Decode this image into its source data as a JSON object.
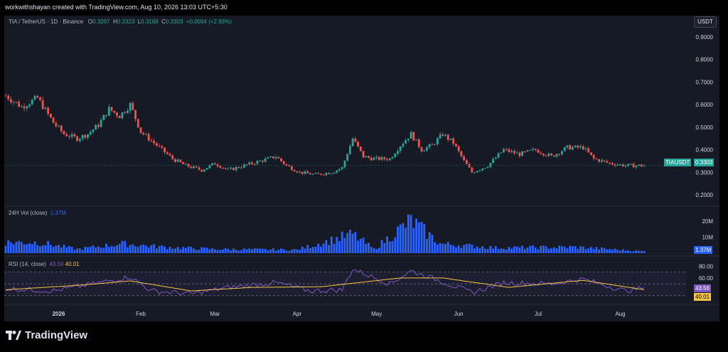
{
  "header": {
    "credit": "workwithshayan created with TradingView.com, Aug 10, 2026 13:03 UTC+5:30"
  },
  "legend": {
    "symbol": "TIA / TetherUS · 1D · Binance",
    "o_label": "O",
    "o": "0.3207",
    "h_label": "H",
    "h": "0.3323",
    "l_label": "L",
    "l": "0.3188",
    "c_label": "C",
    "c": "0.3303",
    "change": "+0.0094 (+2.93%)"
  },
  "currency": "USDT",
  "price_tag": {
    "symbol": "TIAUSDT",
    "value": "0.3303"
  },
  "volume": {
    "label": "24H Vol (close)",
    "value": "1.37M",
    "tag": "1.37M",
    "axis": [
      "20M",
      "10M"
    ]
  },
  "rsi": {
    "label": "RSI (14, close)",
    "value1": "43.56",
    "value2": "40.01",
    "axis": [
      "80.00",
      "60.00"
    ],
    "tag1": "43.56",
    "tag2": "40.01"
  },
  "footer": {
    "brand": "TradingView"
  },
  "colors": {
    "up": "#26a69a",
    "down": "#ef5350",
    "volume": "#2962ff",
    "rsi": "#7e57c2",
    "rsi_ma": "#f7c548",
    "tag_green": "#26a69a"
  },
  "chart_data": [
    {
      "type": "candlestick",
      "title": "TIA / TetherUS · 1D · Binance",
      "ylim": [
        0.15,
        0.95
      ],
      "y_ticks": [
        "0.9000",
        "0.8000",
        "0.7000",
        "0.6000",
        "0.5000",
        "0.4000",
        "0.3000",
        "0.2000"
      ],
      "x_ticks": [
        "2026",
        "Feb",
        "Mar",
        "Apr",
        "May",
        "Jun",
        "Jul",
        "Aug"
      ],
      "last_close": 0.3303,
      "close_path": [
        [
          "2025-12-12",
          0.64
        ],
        [
          "2025-12-18",
          0.59
        ],
        [
          "2025-12-24",
          0.63
        ],
        [
          "2025-12-30",
          0.52
        ],
        [
          "2026-01-03",
          0.47
        ],
        [
          "2026-01-08",
          0.45
        ],
        [
          "2026-01-12",
          0.47
        ],
        [
          "2026-01-16",
          0.51
        ],
        [
          "2026-01-20",
          0.58
        ],
        [
          "2026-01-24",
          0.55
        ],
        [
          "2026-01-28",
          0.6
        ],
        [
          "2026-02-01",
          0.48
        ],
        [
          "2026-02-05",
          0.44
        ],
        [
          "2026-02-09",
          0.4
        ],
        [
          "2026-02-13",
          0.36
        ],
        [
          "2026-02-18",
          0.33
        ],
        [
          "2026-02-24",
          0.31
        ],
        [
          "2026-03-01",
          0.34
        ],
        [
          "2026-03-06",
          0.31
        ],
        [
          "2026-03-12",
          0.33
        ],
        [
          "2026-03-18",
          0.35
        ],
        [
          "2026-03-24",
          0.37
        ],
        [
          "2026-03-28",
          0.33
        ],
        [
          "2026-04-02",
          0.3
        ],
        [
          "2026-04-08",
          0.29
        ],
        [
          "2026-04-14",
          0.3
        ],
        [
          "2026-04-18",
          0.32
        ],
        [
          "2026-04-22",
          0.45
        ],
        [
          "2026-04-26",
          0.37
        ],
        [
          "2026-04-30",
          0.36
        ],
        [
          "2026-05-06",
          0.36
        ],
        [
          "2026-05-10",
          0.42
        ],
        [
          "2026-05-14",
          0.47
        ],
        [
          "2026-05-18",
          0.4
        ],
        [
          "2026-05-22",
          0.42
        ],
        [
          "2026-05-26",
          0.47
        ],
        [
          "2026-05-30",
          0.43
        ],
        [
          "2026-06-03",
          0.35
        ],
        [
          "2026-06-06",
          0.3
        ],
        [
          "2026-06-12",
          0.33
        ],
        [
          "2026-06-18",
          0.4
        ],
        [
          "2026-06-24",
          0.38
        ],
        [
          "2026-06-30",
          0.4
        ],
        [
          "2026-07-06",
          0.37
        ],
        [
          "2026-07-12",
          0.41
        ],
        [
          "2026-07-18",
          0.41
        ],
        [
          "2026-07-22",
          0.36
        ],
        [
          "2026-07-28",
          0.34
        ],
        [
          "2026-08-03",
          0.33
        ],
        [
          "2026-08-10",
          0.3303
        ]
      ]
    },
    {
      "type": "bar",
      "title": "24H Vol (close)",
      "ylim": [
        0,
        25000000
      ],
      "y_ticks": [
        "20M",
        "10M"
      ],
      "last_value": "1.37M",
      "level_path": [
        [
          "2025-12-12",
          8000000
        ],
        [
          "2025-12-24",
          8000000
        ],
        [
          "2026-01-08",
          3000000
        ],
        [
          "2026-01-25",
          7000000
        ],
        [
          "2026-02-10",
          4500000
        ],
        [
          "2026-03-01",
          3000000
        ],
        [
          "2026-04-01",
          2500000
        ],
        [
          "2026-04-22",
          14000000
        ],
        [
          "2026-04-30",
          3000000
        ],
        [
          "2026-05-14",
          24000000
        ],
        [
          "2026-05-25",
          7000000
        ],
        [
          "2026-06-15",
          4000000
        ],
        [
          "2026-07-15",
          4500000
        ],
        [
          "2026-08-10",
          1370000
        ]
      ]
    },
    {
      "type": "line",
      "title": "RSI (14, close)",
      "ylim": [
        20,
        90
      ],
      "y_ticks": [
        "80.00",
        "60.00"
      ],
      "series": [
        {
          "name": "RSI",
          "last": 43.56,
          "values": [
            [
              "2025-12-12",
              42
            ],
            [
              "2025-12-30",
              38
            ],
            [
              "2026-01-08",
              45
            ],
            [
              "2026-01-20",
              55
            ],
            [
              "2026-01-28",
              62
            ],
            [
              "2026-02-05",
              38
            ],
            [
              "2026-02-20",
              33
            ],
            [
              "2026-03-06",
              44
            ],
            [
              "2026-03-24",
              52
            ],
            [
              "2026-04-06",
              38
            ],
            [
              "2026-04-18",
              40
            ],
            [
              "2026-04-22",
              75
            ],
            [
              "2026-05-06",
              50
            ],
            [
              "2026-05-14",
              72
            ],
            [
              "2026-05-22",
              60
            ],
            [
              "2026-06-06",
              35
            ],
            [
              "2026-06-18",
              52
            ],
            [
              "2026-07-06",
              50
            ],
            [
              "2026-07-18",
              58
            ],
            [
              "2026-08-03",
              38
            ],
            [
              "2026-08-10",
              43.56
            ]
          ]
        },
        {
          "name": "RSI-based MA",
          "last": 40.01,
          "values": [
            [
              "2025-12-12",
              40
            ],
            [
              "2026-01-10",
              48
            ],
            [
              "2026-01-28",
              55
            ],
            [
              "2026-02-20",
              38
            ],
            [
              "2026-03-15",
              44
            ],
            [
              "2026-04-10",
              45
            ],
            [
              "2026-05-10",
              60
            ],
            [
              "2026-05-26",
              60
            ],
            [
              "2026-06-20",
              44
            ],
            [
              "2026-07-18",
              56
            ],
            [
              "2026-08-10",
              40.01
            ]
          ]
        }
      ],
      "bands": [
        30,
        50,
        70
      ]
    }
  ]
}
